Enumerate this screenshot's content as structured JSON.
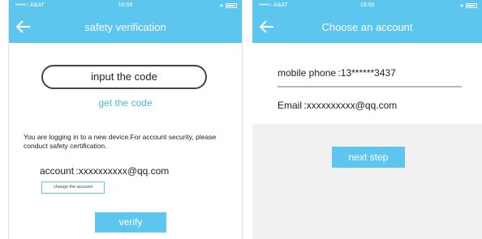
{
  "status": {
    "carrier": "•••••○  A&AT",
    "time": "16:59",
    "bluetooth": "∗",
    "battery": "battery-icon"
  },
  "screen1": {
    "title": "safety verification",
    "code_placeholder": "input the code",
    "get_code": "get the code",
    "notice": "You are logging in to a new device.For account security, please conduct safety certification.",
    "account": "account :xxxxxxxxxx@qq.com",
    "change_account": "change the account",
    "verify": "verify"
  },
  "screen2": {
    "title": "Choose an account",
    "phone": "mobile phone :13******3437",
    "email": "Email :xxxxxxxxxx@qq.com",
    "next": "next step"
  },
  "colors": {
    "accent": "#5cc6ef",
    "link": "#4bb8e6"
  }
}
